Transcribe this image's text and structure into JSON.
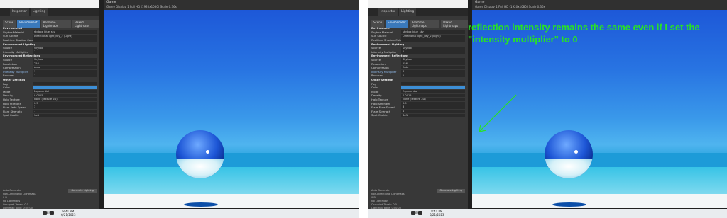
{
  "window": {
    "title": "Game",
    "tabs": [
      "Inspector",
      "Lighting"
    ],
    "controls": [
      "–",
      "□",
      "✕"
    ]
  },
  "lighting": {
    "subtabs": [
      "Scene",
      "Environment",
      "Realtime Lightmaps",
      "Baked Lightmaps"
    ],
    "rows": [
      {
        "label": "Environment",
        "value": "",
        "type": "head"
      },
      {
        "label": "Skybox Material",
        "value": "skybox_blue_sky"
      },
      {
        "label": "Sun Source",
        "value": "Directional light_key_2 (Light)"
      },
      {
        "label": "Realtime Shadow Color",
        "value": "",
        "type": "color"
      },
      {
        "label": "Environment Lighting",
        "value": "",
        "type": "head"
      },
      {
        "label": "Source",
        "value": "Skybox"
      },
      {
        "label": "Intensity Multiplier",
        "value": "1"
      },
      {
        "label": "Environment Reflections",
        "value": "",
        "type": "head"
      },
      {
        "label": "Source",
        "value": "Skybox"
      },
      {
        "label": "Resolution",
        "value": "256"
      },
      {
        "label": "Compression",
        "value": "Auto"
      },
      {
        "label": "Intensity Multiplier",
        "value": "1",
        "type": "hl"
      },
      {
        "label": "Bounces",
        "value": "1"
      },
      {
        "label": "Other Settings",
        "value": "",
        "type": "head"
      },
      {
        "label": "Fog",
        "value": ""
      },
      {
        "label": "Color",
        "value": "",
        "type": "blue"
      },
      {
        "label": "Mode",
        "value": "Exponential"
      },
      {
        "label": "Density",
        "value": "0.0015"
      },
      {
        "label": "Halo Texture",
        "value": "None (Texture 2D)"
      },
      {
        "label": "Halo Strength",
        "value": "0.5"
      },
      {
        "label": "Flare Fade Speed",
        "value": "3"
      },
      {
        "label": "Flare Strength",
        "value": "1"
      },
      {
        "label": "Spot Cookie",
        "value": "Soft"
      }
    ],
    "auto_generate": "Auto Generate",
    "generate_btn": "Generate Lighting",
    "info": [
      "Non-Directional Lightmaps",
      "0 B",
      "No Lightmaps",
      "Occupied Texels: 0.0",
      "Lightmap Bake: 0:00:00"
    ]
  },
  "game_view": {
    "label": "Game",
    "toolbar": "Game  Display 1  Full HD (1920x1080)  Scale  0.36x"
  },
  "taskbar": {
    "lang": "ENG",
    "time": "8:41 PM",
    "date": "6/21/2023"
  },
  "annotation": {
    "text": "reflection intensity remains the same even if I set the \"intensity multiplier\" to 0"
  },
  "right_rows_override": {
    "intensity_multiplier": "0"
  },
  "colors": {
    "accent_green": "#28e028",
    "sky_blue": "#2874e2",
    "panel_bg": "#383838"
  }
}
